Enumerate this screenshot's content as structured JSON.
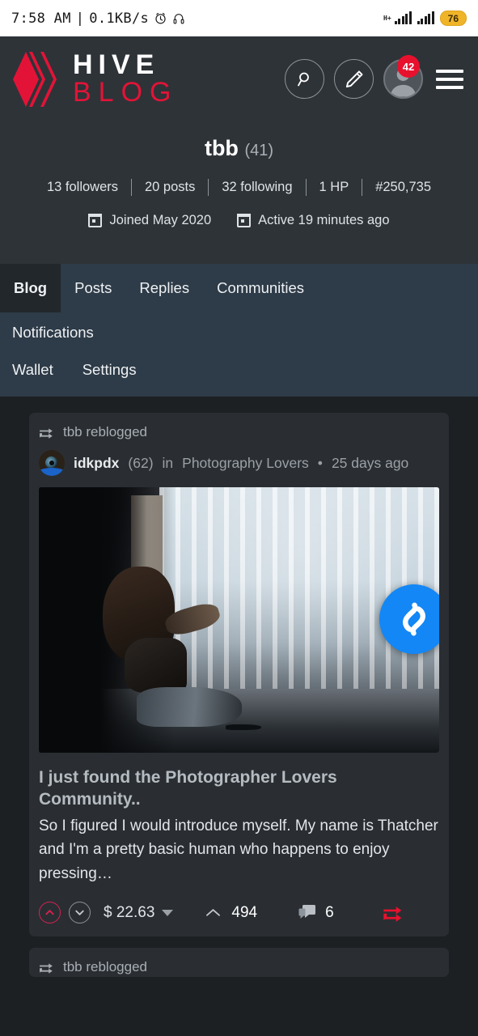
{
  "status_bar": {
    "time": "7:58 AM",
    "divider": "|",
    "data_rate": "0.1KB/s",
    "alarm_icon": "alarm-clock-icon",
    "headset_icon": "headset-icon",
    "network_type": "H+",
    "battery_percent": "76"
  },
  "header": {
    "brand_line1": "HIVE",
    "brand_line2": "BLOG",
    "logo_icon": "hive-logo-icon",
    "search_icon": "search-icon",
    "compose_icon": "pencil-icon",
    "avatar_icon": "user-avatar-icon",
    "notification_count": "42",
    "menu_icon": "hamburger-menu-icon",
    "brand_red": "#e31337"
  },
  "profile": {
    "username": "tbb",
    "reputation": "(41)",
    "stats": [
      "13 followers",
      "20 posts",
      "32 following",
      "1 HP",
      "#250,735"
    ],
    "joined": "Joined May 2020",
    "active": "Active 19 minutes ago",
    "calendar_icon": "calendar-icon"
  },
  "nav": {
    "row1": [
      {
        "label": "Blog",
        "active": true
      },
      {
        "label": "Posts",
        "active": false
      },
      {
        "label": "Replies",
        "active": false
      },
      {
        "label": "Communities",
        "active": false
      }
    ],
    "row2": [
      {
        "label": "Notifications",
        "active": false
      }
    ],
    "row3": [
      {
        "label": "Wallet",
        "active": false
      },
      {
        "label": "Settings",
        "active": false
      }
    ]
  },
  "feed": {
    "posts": [
      {
        "reblog_text": "tbb reblogged",
        "reblog_icon": "reblog-arrow-icon",
        "author": "idkpdx",
        "author_reputation": "(62)",
        "in_word": "in",
        "community": "Photography Lovers",
        "separator": "•",
        "age": "25 days ago",
        "avatar_icon": "author-avatar-icon",
        "image_alt": "woman sitting on floor by window with lace curtains",
        "title": "I just found the Photographer Lovers Community..",
        "excerpt": "So I figured I would introduce myself. My name is Thatcher and I'm a pretty basic human who happens to enjoy pressing…",
        "upvote_icon": "upvote-chevron-icon",
        "downvote_icon": "downvote-chevron-icon",
        "payout": "$ 22.63",
        "payout_caret_icon": "caret-down-icon",
        "vote_count": "494",
        "vote_icon": "chevron-up-icon",
        "comment_count": "6",
        "comment_icon": "comment-bubble-icon",
        "resteem_icon": "resteem-arrow-icon"
      },
      {
        "reblog_text": "tbb reblogged",
        "reblog_icon": "reblog-arrow-icon"
      }
    ]
  },
  "overlay": {
    "shazam_icon": "shazam-floating-button",
    "shazam_color": "#1387f5"
  }
}
